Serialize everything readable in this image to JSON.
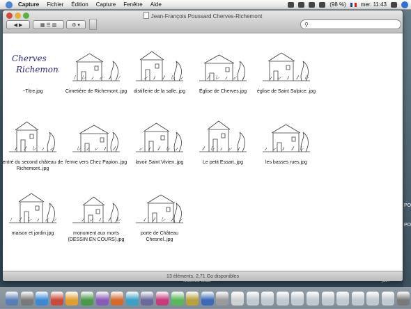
{
  "menubar": {
    "app": "Capture",
    "items": [
      "Fichier",
      "Édition",
      "Capture",
      "Fenêtre",
      "Aide"
    ],
    "battery": "(98 %)",
    "clock": "mer. 11:43"
  },
  "window": {
    "title": "Jean-François Poussard Cherves-Richemont",
    "search_placeholder": "",
    "status": "13 éléments, 2,71 Go disponibles"
  },
  "toolbar": {
    "nav_label": "◀ ▶",
    "view_label": "▦ ☰ ▥",
    "action_label": "⚙ ▾"
  },
  "files": [
    {
      "name": "~Titre.jpg",
      "kind": "title"
    },
    {
      "name": "Cimetière de Richemont..jpg",
      "kind": "sketch"
    },
    {
      "name": "distillerie de la salle..jpg",
      "kind": "sketch"
    },
    {
      "name": "Église de Cherves.jpg",
      "kind": "sketch"
    },
    {
      "name": "église de Saint Sulpice..jpg",
      "kind": "sketch"
    },
    {
      "name": "entré du second château de Richemont..jpg",
      "kind": "sketch"
    },
    {
      "name": "ferme vers Chez Papion..jpg",
      "kind": "sketch"
    },
    {
      "name": "lavoir Saint Vivien..jpg",
      "kind": "sketch"
    },
    {
      "name": "Le petit Essart..jpg",
      "kind": "sketch"
    },
    {
      "name": "les basses rues.jpg",
      "kind": "sketch"
    },
    {
      "name": "maison et jardin.jpg",
      "kind": "sketch"
    },
    {
      "name": "monument aux morts (DESSIN EN COURS).jpg",
      "kind": "sketch"
    },
    {
      "name": "porte de Château Chesnel..jpg",
      "kind": "sketch"
    }
  ],
  "title_art": {
    "line1": "Cherves",
    "line2": "Richemont"
  },
  "desktop": {
    "label_right_1": "PO",
    "label_right_2": "PO",
    "file_label": "loc2.xls alias",
    "file_label_2": "juin"
  },
  "colors": {
    "accent": "#2f6fd6",
    "sketch_ink": "#3a3a3a",
    "title_ink": "#2b2b8a"
  }
}
